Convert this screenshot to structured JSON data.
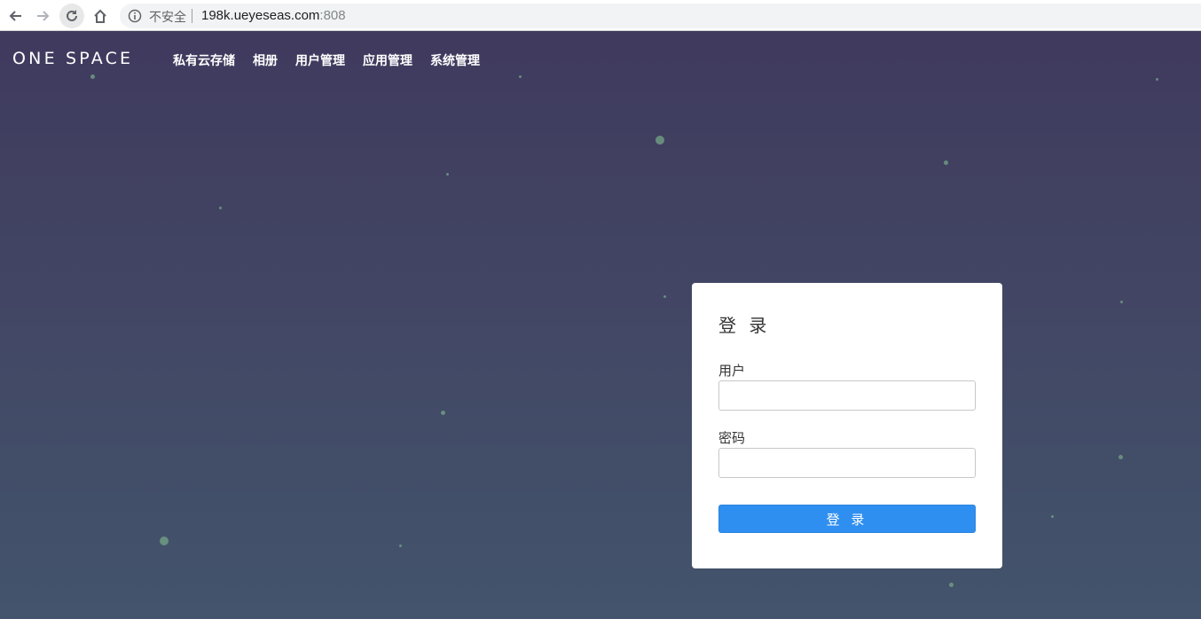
{
  "browser": {
    "security_label": "不安全",
    "url_host": "198k.ueyeseas.com",
    "url_port": ":808"
  },
  "header": {
    "logo": "ONE SPACE",
    "nav": [
      "私有云存储",
      "相册",
      "用户管理",
      "应用管理",
      "系统管理"
    ]
  },
  "login": {
    "title": "登 录",
    "user_label": "用户",
    "user_value": "",
    "password_label": "密码",
    "password_value": "",
    "submit_label": "登 录"
  },
  "colors": {
    "page_bg_top": "#403a5e",
    "page_bg_bottom": "#43546c",
    "button": "#2f8ff0",
    "star": "#6f9a82"
  }
}
